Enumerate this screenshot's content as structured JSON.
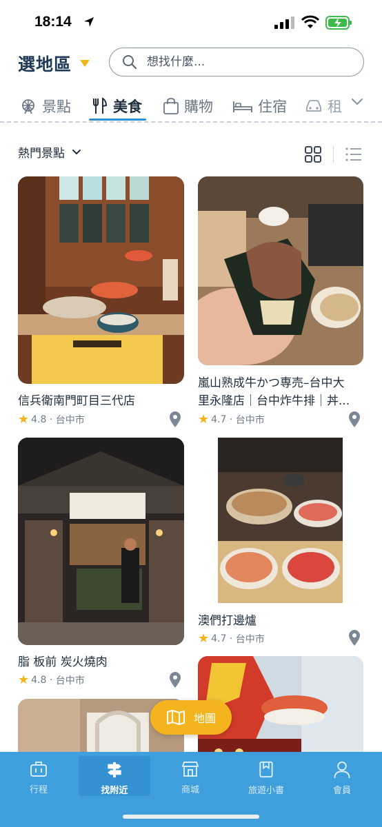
{
  "status_bar": {
    "time": "18:14"
  },
  "header": {
    "region": "選地區",
    "search_placeholder": "想找什麼..."
  },
  "categories": [
    {
      "label": "景點",
      "icon": "ferris-wheel-icon"
    },
    {
      "label": "美食",
      "icon": "fork-knife-icon",
      "active": true
    },
    {
      "label": "購物",
      "icon": "shopping-bag-icon"
    },
    {
      "label": "住宿",
      "icon": "bed-icon"
    },
    {
      "label": "租",
      "icon": "car-icon"
    }
  ],
  "filter": {
    "label": "熱門景點"
  },
  "cards": [
    {
      "title": "信兵衛南門町目三代店",
      "rating": "4.8",
      "city": "台中市"
    },
    {
      "title": "嵐山熟成牛かつ専売–台中大",
      "title_line2": "里永隆店｜台中炸牛排｜丼...",
      "rating": "4.7",
      "city": "台中市"
    },
    {
      "title": "脂 板前 炭火燒肉",
      "rating": "4.8",
      "city": "台中市"
    },
    {
      "title": "澳們打邊爐",
      "rating": "4.7",
      "city": "台中市"
    }
  ],
  "map_button": {
    "label": "地圖"
  },
  "tabbar": [
    {
      "label": "行程",
      "icon": "briefcase-icon"
    },
    {
      "label": "找附近",
      "icon": "signpost-icon",
      "active": true
    },
    {
      "label": "商城",
      "icon": "store-icon"
    },
    {
      "label": "旅遊小書",
      "icon": "book-icon"
    },
    {
      "label": "會員",
      "icon": "person-icon"
    }
  ],
  "colors": {
    "accent_yellow": "#f4b41e",
    "tabbar_blue": "#3f9fdc",
    "underline_blue": "#2e8fd6",
    "title_navy": "#1f3a57"
  }
}
